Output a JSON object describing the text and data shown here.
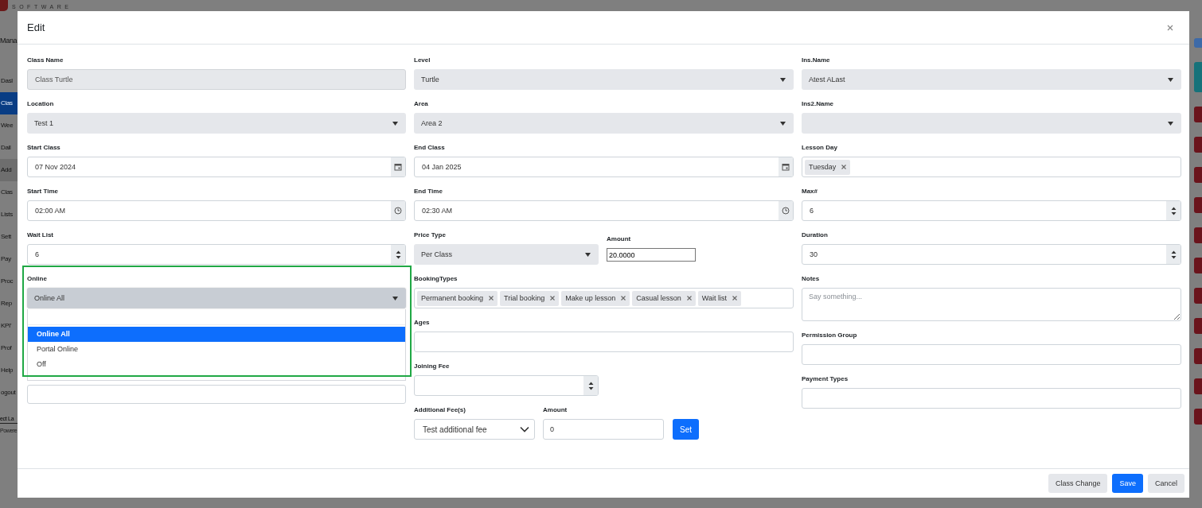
{
  "background": {
    "logo": "SOFTWARE",
    "heading": "Mana",
    "sidebar_items": [
      {
        "label": "Dasl",
        "kind": "link",
        "selected": false
      },
      {
        "label": "Clas",
        "kind": "link",
        "selected": true
      },
      {
        "label": "Wee",
        "kind": "link",
        "selected": false
      },
      {
        "label": "Dail",
        "kind": "link",
        "selected": false
      },
      {
        "label": "Add",
        "kind": "group",
        "selected": false
      },
      {
        "label": "Clas",
        "kind": "link",
        "selected": false
      },
      {
        "label": "Lists",
        "kind": "link",
        "selected": false
      },
      {
        "label": "Sett",
        "kind": "link",
        "selected": false
      },
      {
        "label": "Pay",
        "kind": "link",
        "selected": false
      },
      {
        "label": "Proc",
        "kind": "link",
        "selected": false
      },
      {
        "label": "Rep",
        "kind": "link",
        "selected": false
      },
      {
        "label": "KPI'",
        "kind": "link",
        "selected": false
      },
      {
        "label": "Prof",
        "kind": "link",
        "selected": false
      },
      {
        "label": "Help",
        "kind": "link",
        "selected": false
      },
      {
        "label": "ogout",
        "kind": "link",
        "selected": false
      }
    ],
    "language_link": "ect La",
    "powered_note": "Powere"
  },
  "dialog": {
    "title": "Edit",
    "columns": [
      [
        {
          "kind": "static",
          "label": "Class Name",
          "value": "Class Turtle"
        },
        {
          "kind": "select",
          "label": "Location",
          "value": "Test 1"
        },
        {
          "kind": "date",
          "label": "Start Class",
          "value": "07 Nov 2024"
        },
        {
          "kind": "time",
          "label": "Start Time",
          "value": "02:00 AM"
        },
        {
          "kind": "number",
          "label": "Wait List",
          "value": "6"
        },
        {
          "kind": "open-select",
          "label": "Online",
          "value": "Online All",
          "options": [
            {
              "label": "Online All",
              "selected": true
            },
            {
              "label": "Portal Online",
              "selected": false
            },
            {
              "label": "Off",
              "selected": false
            }
          ]
        },
        {
          "kind": "bare"
        }
      ],
      [
        {
          "kind": "select",
          "label": "Level",
          "value": "Turtle"
        },
        {
          "kind": "select",
          "label": "Area",
          "value": "Area 2"
        },
        {
          "kind": "date",
          "label": "End Class",
          "value": "04 Jan 2025"
        },
        {
          "kind": "time",
          "label": "End Time",
          "value": "02:30 AM"
        },
        {
          "kind": "row",
          "items": [
            {
              "kind": "select",
              "label": "Price Type",
              "value": "Per Class"
            },
            {
              "kind": "plain",
              "label": "Amount",
              "value": "20.0000"
            }
          ]
        },
        {
          "kind": "tags",
          "label": "BookingTypes",
          "tags": [
            "Permanent booking",
            "Trial booking",
            "Make up lesson",
            "Casual lesson",
            "Wait list"
          ]
        },
        {
          "kind": "text",
          "label": "Ages"
        },
        {
          "kind": "row",
          "items": [
            {
              "kind": "number",
              "label": "Joining Fee"
            }
          ]
        },
        {
          "kind": "row",
          "items": [
            {
              "kind": "native-select",
              "label": "Additional Fee(s)",
              "value": "Test additional fee"
            },
            {
              "kind": "text",
              "label": "Amount",
              "value": "0"
            }
          ],
          "button": "Set"
        }
      ],
      [
        {
          "kind": "select",
          "label": "Ins.Name",
          "value": "Atest ALast"
        },
        {
          "kind": "select",
          "label": "Ins2.Name"
        },
        {
          "kind": "tags",
          "label": "Lesson Day",
          "tags": [
            "Tuesday"
          ]
        },
        {
          "kind": "number",
          "label": "Max#",
          "value": "6"
        },
        {
          "kind": "number",
          "label": "Duration",
          "value": "30"
        },
        {
          "kind": "textarea",
          "label": "Notes",
          "placeholder": "Say something..."
        },
        {
          "kind": "text",
          "label": "Permission Group"
        },
        {
          "kind": "text",
          "label": "Payment Types"
        }
      ]
    ],
    "buttons": [
      {
        "label": "Class Change",
        "kind": "secondary"
      },
      {
        "label": "Save",
        "kind": "primary"
      },
      {
        "label": "Cancel",
        "kind": "secondary"
      }
    ]
  }
}
